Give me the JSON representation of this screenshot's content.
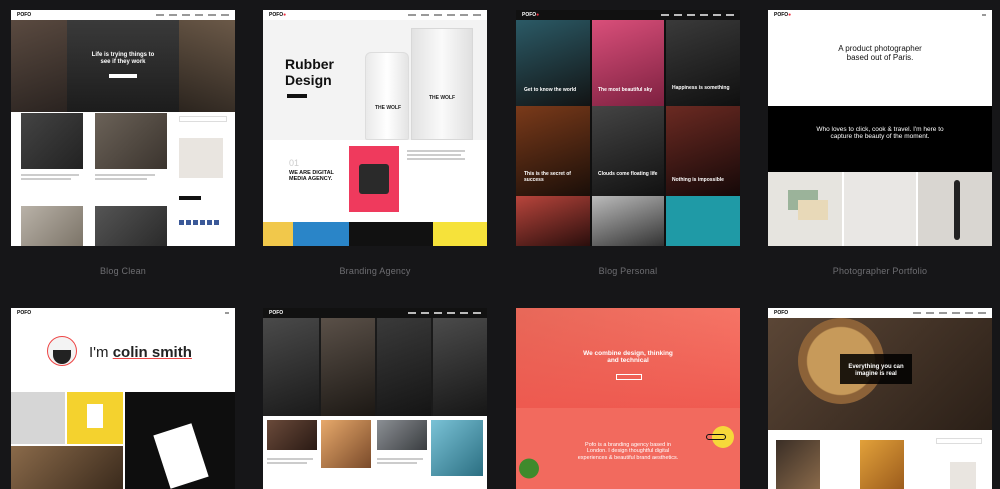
{
  "demos": [
    {
      "caption": "Blog Clean",
      "logo": "POFO",
      "hero": "Life is trying things to see if they work"
    },
    {
      "caption": "Branding Agency",
      "hero": "Rubber Design",
      "bottle": "THE WOLF",
      "bag": "THE WOLF",
      "number": "01",
      "tagline": "WE ARE DIGITAL MEDIA AGENCY."
    },
    {
      "caption": "Blog Personal",
      "posts": [
        "Get to know the world",
        "The most beautiful sky",
        "Happiness is something",
        "This is the secret of success",
        "Clouds come floating life",
        "Nothing is impossible"
      ]
    },
    {
      "caption": "Photographer Portfolio",
      "hero": "A product photographer based out of Paris.",
      "band": "Who loves to click, cook & travel. I'm here to capture the beauty of the moment."
    },
    {
      "logo": "POFO",
      "hero_prefix": "I'm",
      "hero_name": "colin smith"
    },
    {
      "logo": "POFO"
    },
    {
      "logo": "pofo",
      "hero": "We combine design, thinking and technical",
      "body": "Pofo is a branding agency based in London. I design thoughtful digital experiences & beautiful brand aesthetics."
    },
    {
      "logo": "POFO",
      "hero": "Everything you can imagine is real"
    }
  ],
  "colors": {
    "background": "#161618",
    "caption": "#6e6e72",
    "accent_red": "#ee3344",
    "coral": "#f26a5e",
    "yellow": "#f6d83a"
  }
}
